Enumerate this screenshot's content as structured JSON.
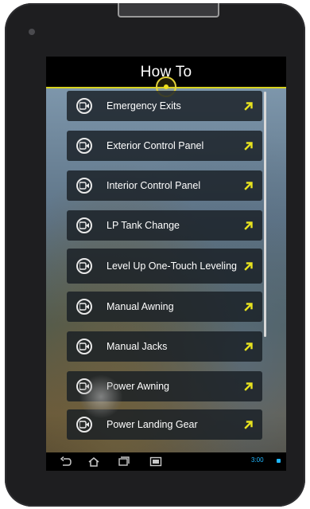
{
  "header": {
    "title": "How To"
  },
  "menu": {
    "items": [
      {
        "label": "Emergency Exits"
      },
      {
        "label": "Exterior Control Panel"
      },
      {
        "label": "Interior Control Panel"
      },
      {
        "label": "LP Tank Change"
      },
      {
        "label": "Level Up One-Touch Leveling"
      },
      {
        "label": "Manual Awning"
      },
      {
        "label": "Manual Jacks"
      },
      {
        "label": "Power Awning"
      },
      {
        "label": "Power Landing Gear"
      }
    ]
  },
  "status_bar": {
    "time": "3:00"
  },
  "colors": {
    "accent": "#d7d21e",
    "arrow": "#e7e21f",
    "item_bg": "#191e24"
  },
  "icons": {
    "item_icon": "play-circle-icon",
    "item_action": "arrow-up-right-icon",
    "nav": [
      "back-icon",
      "home-icon",
      "recent-apps-icon",
      "screenshot-icon"
    ]
  }
}
